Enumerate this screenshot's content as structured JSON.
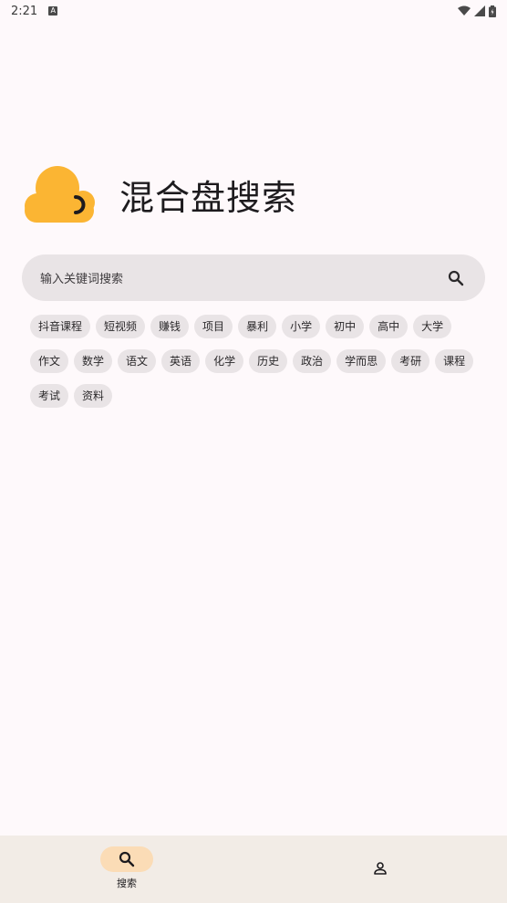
{
  "status": {
    "time": "2:21",
    "notif_letter": "A"
  },
  "app": {
    "title": "混合盘搜索"
  },
  "search": {
    "placeholder": "输入关键词搜索"
  },
  "tags": [
    "抖音课程",
    "短视频",
    "赚钱",
    "项目",
    "暴利",
    "小学",
    "初中",
    "高中",
    "大学",
    "作文",
    "数学",
    "语文",
    "英语",
    "化学",
    "历史",
    "政治",
    "学而思",
    "考研",
    "课程",
    "考试",
    "资料"
  ],
  "nav": {
    "search_label": "搜索"
  },
  "colors": {
    "accent": "#fbb533",
    "nav_bg": "#f2ece6",
    "pill": "#fbdcb6",
    "chip": "#e9e4e6"
  },
  "icons": {
    "logo": "cloud-logo-icon",
    "search": "search-icon",
    "profile": "person-icon"
  }
}
